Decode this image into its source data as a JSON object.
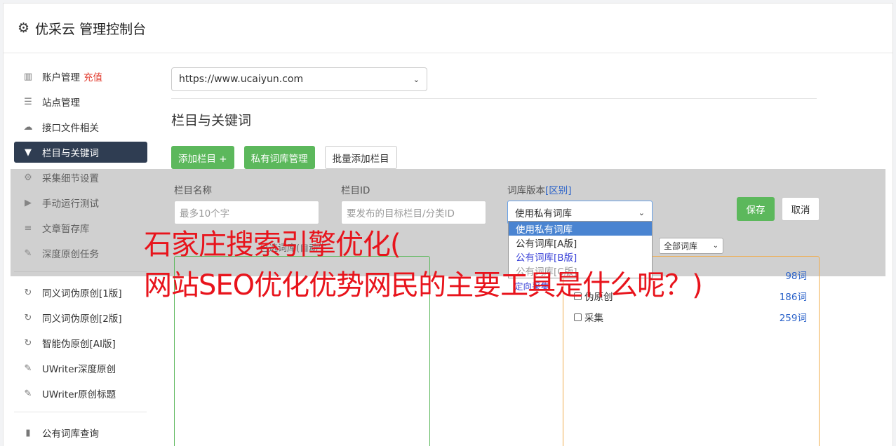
{
  "header": {
    "title": "优采云 管理控制台"
  },
  "sidebar": {
    "items": [
      {
        "label": "账户管理",
        "badge": "充值",
        "icon": "bar-chart-icon"
      },
      {
        "label": "站点管理",
        "icon": "server-icon"
      },
      {
        "label": "接口文件相关",
        "icon": "cloud-upload-icon"
      },
      {
        "label": "栏目与关键词",
        "icon": "filter-icon",
        "active": true
      },
      {
        "label": "采集细节设置",
        "icon": "cogs-icon"
      },
      {
        "label": "手动运行测试",
        "icon": "play-icon"
      },
      {
        "label": "文章暂存库",
        "icon": "database-icon"
      },
      {
        "label": "深度原创任务",
        "icon": "edit-icon"
      }
    ],
    "items2": [
      {
        "label": "同义词伪原创[1版]",
        "icon": "refresh-icon"
      },
      {
        "label": "同义词伪原创[2版]",
        "icon": "refresh-icon"
      },
      {
        "label": "智能伪原创[AI版]",
        "icon": "refresh-icon"
      },
      {
        "label": "UWriter深度原创",
        "icon": "edit-icon"
      },
      {
        "label": "UWriter原创标题",
        "icon": "edit-icon"
      }
    ],
    "items3": [
      {
        "label": "公有词库查询",
        "icon": "book-icon"
      }
    ]
  },
  "main": {
    "site_select": "https://www.ucaiyun.com",
    "section_title": "栏目与关键词",
    "buttons": {
      "add_column": "添加栏目 +",
      "private_lib": "私有词库管理",
      "batch_add": "批量添加栏目"
    },
    "form": {
      "name_label": "栏目名称",
      "name_placeholder": "最多10个字",
      "id_label": "栏目ID",
      "id_placeholder": "要发布的目标栏目/分类ID",
      "lib_label": "词库版本",
      "lib_label_link": "[区别]",
      "lib_selected": "使用私有词库",
      "save": "保存",
      "cancel": "取消"
    },
    "dropdown_options": [
      "使用私有词库",
      "公有词库[A版]",
      "公有词库[B版]",
      "公有词库[C版]"
    ],
    "collect_link": "定向采集",
    "sub_label": "已选词库(自动生",
    "filter_select": "全部词库",
    "libraries": [
      {
        "name": "",
        "count": "98词"
      },
      {
        "name": "伪原创",
        "count": "186词"
      },
      {
        "name": "采集",
        "count": "259词"
      }
    ]
  },
  "watermark": {
    "line1": "石家庄搜索引擎优化(",
    "line2": "网站SEO优化优势网民的主要工具是什么呢？)"
  }
}
